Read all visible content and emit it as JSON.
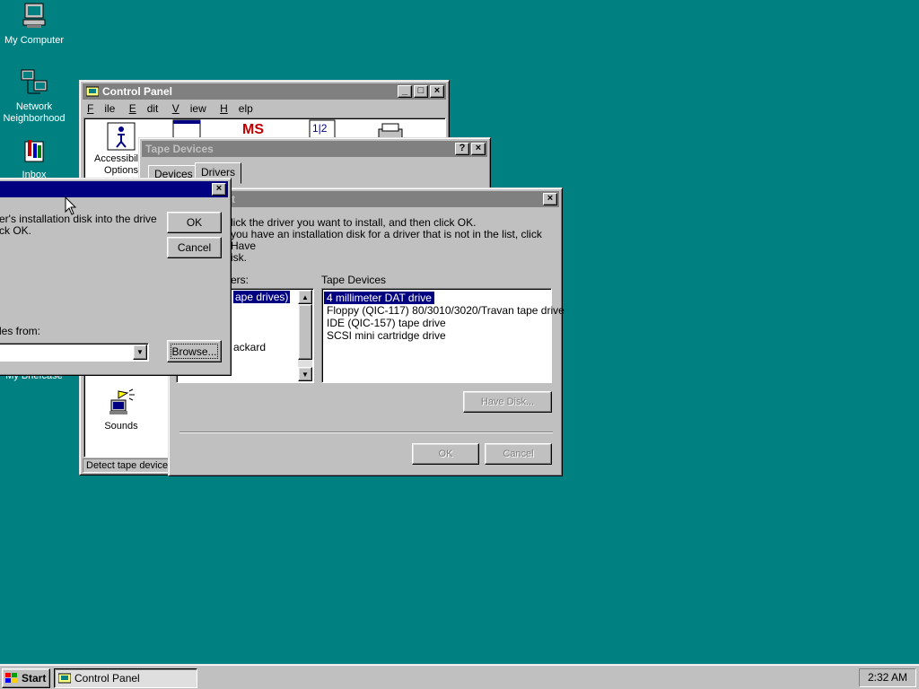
{
  "desktop": {
    "icons": [
      {
        "label": "My Computer"
      },
      {
        "label": "Network Neighborhood"
      },
      {
        "label": "Inbox"
      },
      {
        "label": "My Briefcase"
      }
    ]
  },
  "control_panel": {
    "title": "Control Panel",
    "menu": [
      "File",
      "Edit",
      "View",
      "Help"
    ],
    "icons": [
      {
        "label": "Accessibility Options"
      },
      {
        "label": "Sounds"
      }
    ],
    "status": "Detect tape device"
  },
  "tape_devices": {
    "title": "Tape Devices",
    "tabs": [
      "Devices",
      "Drivers"
    ]
  },
  "select_device": {
    "title_fragment": "t",
    "instructions_line1": "lick the driver you want to install, and then click OK.",
    "instructions_line2": "you have an installation disk for a driver that is not in the list, click Have",
    "instructions_line3": "isk.",
    "manufacturers_label": "ers:",
    "manufacturers": [
      "ape drives)",
      "ackard"
    ],
    "models_label": "Tape Devices",
    "models": [
      "4 millimeter DAT drive",
      "Floppy (QIC-117) 80/3010/3020/Travan tape drive",
      "IDE (QIC-157) tape drive",
      "SCSI mini cartridge drive"
    ],
    "have_disk": "Have Disk...",
    "ok": "OK",
    "cancel": "Cancel"
  },
  "install_disk": {
    "message_line1": "er's installation disk into the drive",
    "message_line2": "ck OK.",
    "copy_from_label": "les from:",
    "ok": "OK",
    "cancel": "Cancel",
    "browse": "Browse..."
  },
  "taskbar": {
    "start": "Start",
    "task": "Control Panel",
    "clock": "2:32 AM"
  },
  "colors": {
    "desktop": "#008080",
    "titlebar_active": "#000080",
    "titlebar_inactive": "#808080",
    "face": "#c0c0c0"
  }
}
